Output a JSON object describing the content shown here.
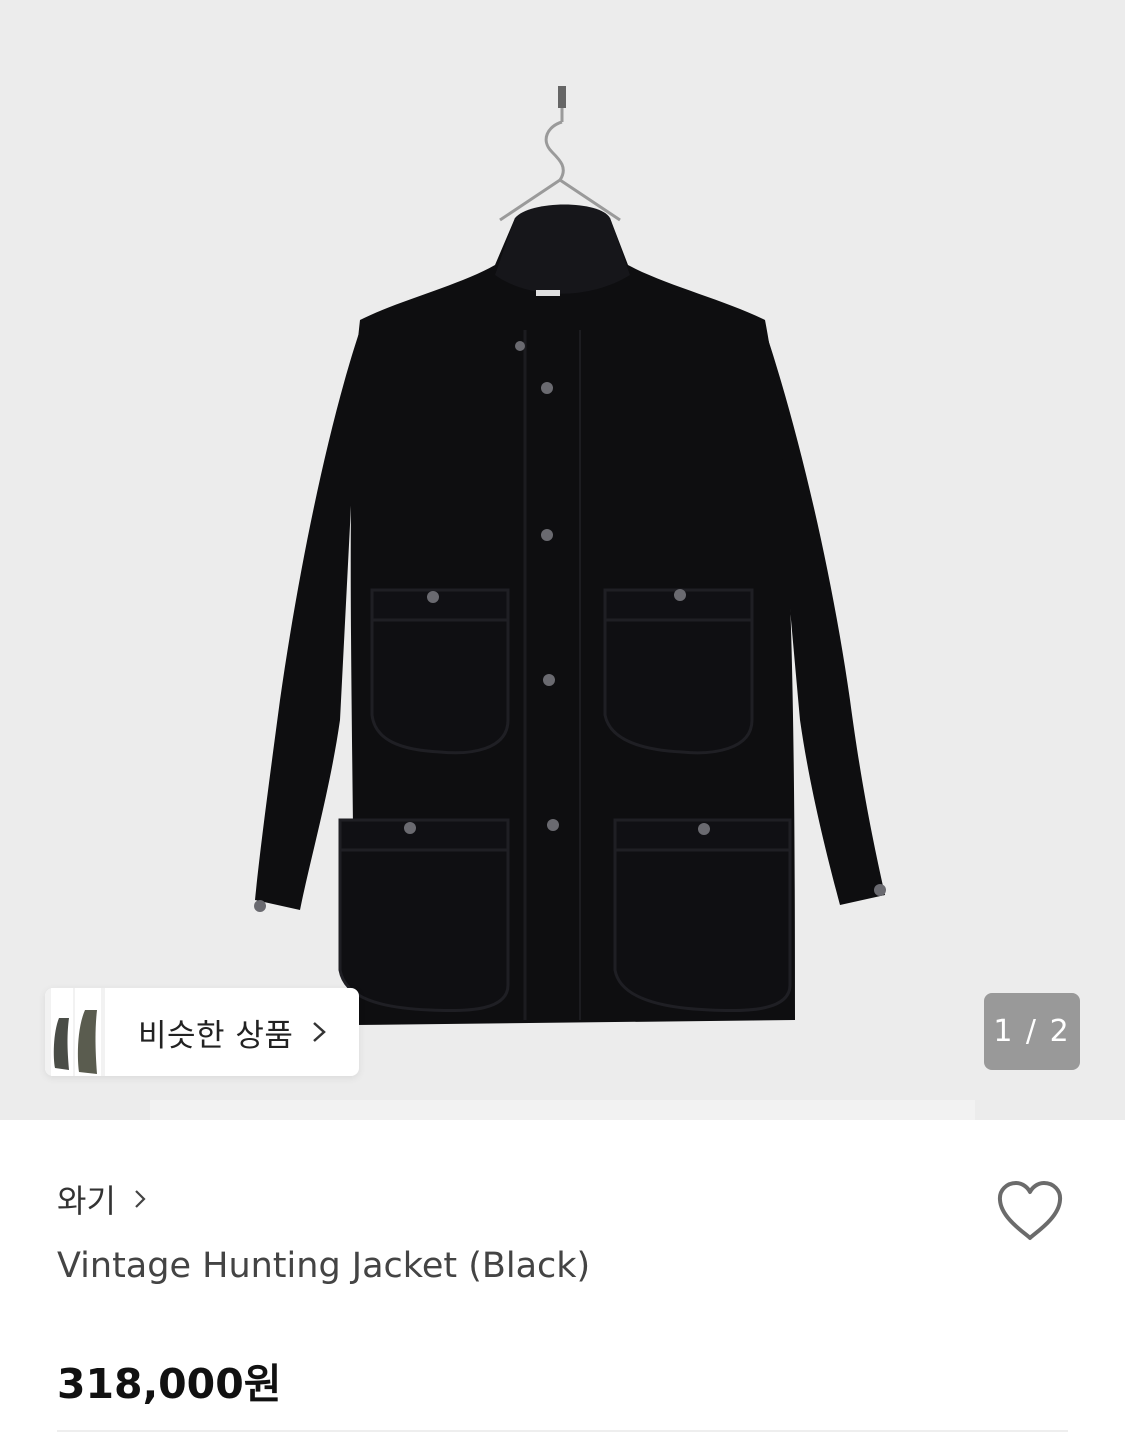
{
  "hero": {
    "similar_label": "비슷한 상품",
    "counter": "1 / 2"
  },
  "product": {
    "brand": "와기",
    "title": "Vintage Hunting Jacket (Black)",
    "price": "318,000원"
  },
  "colors": {
    "background": "#ececec",
    "jacket": "#0e0e10",
    "counter_bg": "#787878"
  },
  "icons": {
    "similar": "chevron-right-icon",
    "brand": "chevron-right-icon",
    "wish": "heart-outline-icon"
  }
}
